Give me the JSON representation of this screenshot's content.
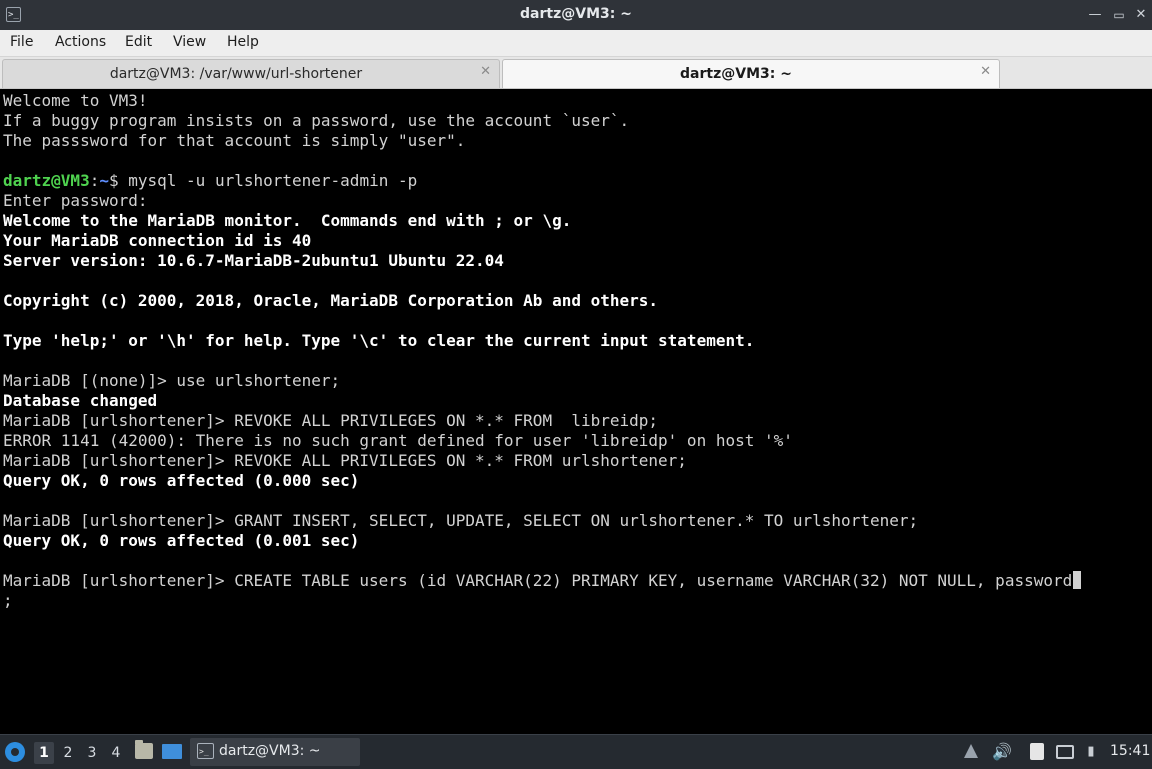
{
  "window": {
    "title": "dartz@VM3: ~",
    "app_icon": "terminal-icon",
    "controls": [
      "minimize-icon",
      "restore-icon",
      "close-icon"
    ]
  },
  "menu": {
    "items": [
      "File",
      "Actions",
      "Edit",
      "View",
      "Help"
    ]
  },
  "tabs": [
    {
      "label": "dartz@VM3: /var/www/url-shortener",
      "active": false,
      "close_icon": "close-icon"
    },
    {
      "label": "dartz@VM3: ~",
      "active": true,
      "close_icon": "close-icon"
    }
  ],
  "terminal": {
    "lines": [
      {
        "segments": [
          {
            "text": "Welcome to VM3!",
            "style": "normal"
          }
        ]
      },
      {
        "segments": [
          {
            "text": "If a buggy program insists on a password, use the account `user`.",
            "style": "normal"
          }
        ]
      },
      {
        "segments": [
          {
            "text": "The passsword for that account is simply \"user\".",
            "style": "normal"
          }
        ]
      },
      {
        "segments": []
      },
      {
        "segments": [
          {
            "text": "dartz@VM3",
            "style": "prompt-user"
          },
          {
            "text": ":",
            "style": "prompt-sep"
          },
          {
            "text": "~",
            "style": "prompt-path"
          },
          {
            "text": "$ mysql -u urlshortener-admin -p",
            "style": "normal"
          }
        ]
      },
      {
        "segments": [
          {
            "text": "Enter password:",
            "style": "normal"
          }
        ]
      },
      {
        "segments": [
          {
            "text": "Welcome to the MariaDB monitor.  Commands end with ; or \\g.",
            "style": "bold"
          }
        ]
      },
      {
        "segments": [
          {
            "text": "Your MariaDB connection id is 40",
            "style": "bold"
          }
        ]
      },
      {
        "segments": [
          {
            "text": "Server version: 10.6.7-MariaDB-2ubuntu1 Ubuntu 22.04",
            "style": "bold"
          }
        ]
      },
      {
        "segments": []
      },
      {
        "segments": [
          {
            "text": "Copyright (c) 2000, 2018, Oracle, MariaDB Corporation Ab and others.",
            "style": "bold"
          }
        ]
      },
      {
        "segments": []
      },
      {
        "segments": [
          {
            "text": "Type 'help;' or '\\h' for help. Type '\\c' to clear the current input statement.",
            "style": "bold"
          }
        ]
      },
      {
        "segments": []
      },
      {
        "segments": [
          {
            "text": "MariaDB [(none)]> use urlshortener;",
            "style": "normal"
          }
        ]
      },
      {
        "segments": [
          {
            "text": "Database changed",
            "style": "bold"
          }
        ]
      },
      {
        "segments": [
          {
            "text": "MariaDB [urlshortener]> REVOKE ALL PRIVILEGES ON *.* FROM  libreidp;",
            "style": "normal"
          }
        ]
      },
      {
        "segments": [
          {
            "text": "ERROR 1141 (42000): There is no such grant defined for user 'libreidp' on host '%'",
            "style": "normal"
          }
        ]
      },
      {
        "segments": [
          {
            "text": "MariaDB [urlshortener]> REVOKE ALL PRIVILEGES ON *.* FROM urlshortener;",
            "style": "normal"
          }
        ]
      },
      {
        "segments": [
          {
            "text": "Query OK, 0 rows affected (0.000 sec)",
            "style": "bold"
          }
        ]
      },
      {
        "segments": []
      },
      {
        "segments": [
          {
            "text": "MariaDB [urlshortener]> GRANT INSERT, SELECT, UPDATE, SELECT ON urlshortener.* TO urlshortener;",
            "style": "normal"
          }
        ]
      },
      {
        "segments": [
          {
            "text": "Query OK, 0 rows affected (0.001 sec)",
            "style": "bold"
          }
        ]
      },
      {
        "segments": []
      },
      {
        "segments": [
          {
            "text": "MariaDB [urlshortener]> CREATE TABLE users (id VARCHAR(22) PRIMARY KEY, username VARCHAR(32) NOT NULL, password",
            "style": "normal"
          }
        ],
        "cursor": true
      },
      {
        "segments": [
          {
            "text": ";",
            "style": "normal"
          }
        ]
      }
    ]
  },
  "taskbar": {
    "launcher_icon": "start-menu-icon",
    "workspaces": [
      "1",
      "2",
      "3",
      "4"
    ],
    "active_workspace": "1",
    "quicklaunch": [
      "file-manager-icon",
      "show-desktop-icon"
    ],
    "task": {
      "label": "dartz@VM3: ~",
      "icon": "terminal-icon"
    },
    "tray": [
      "tray-expand-icon",
      "volume-icon",
      "clipboard-icon",
      "network-icon",
      "battery-icon"
    ],
    "clock": "15:41"
  }
}
